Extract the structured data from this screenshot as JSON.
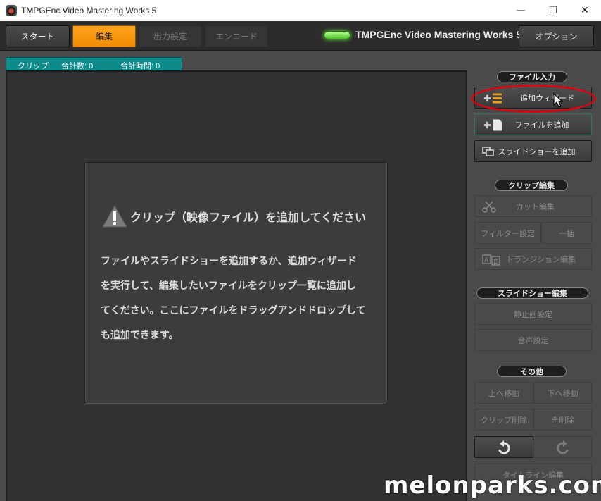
{
  "window": {
    "title": "TMPGEnc Video Mastering Works 5",
    "minimize": "—",
    "maximize": "☐",
    "close": "✕"
  },
  "toolbar": {
    "start": "スタート",
    "edit": "編集",
    "output_settings": "出力設定",
    "encode": "エンコード",
    "brand": "TMPGEnc Video Mastering Works 5",
    "options": "オプション"
  },
  "clip_tab": {
    "label": "クリップ",
    "total_count": "合計数:  0",
    "total_time": "合計時間:  0"
  },
  "message": {
    "title": "クリップ（映像ファイル）を追加してください",
    "lines": [
      "ファイルやスライドショーを追加するか、追加ウィザード",
      "を実行して、編集したいファイルをクリップ一覧に追加し",
      "てください。ここにファイルをドラッグアンドドロップして",
      "も追加できます。"
    ]
  },
  "side": {
    "file_input": "ファイル入力",
    "add_wizard": "追加ウィザード",
    "add_file": "ファイルを追加",
    "add_slideshow": "スライドショーを追加",
    "clip_edit": "クリップ編集",
    "cut_edit": "カット編集",
    "filter_settings": "フィルター設定",
    "batch": "一括",
    "transition_edit": "トランジション編集",
    "slideshow_edit": "スライドショー編集",
    "still_settings": "静止画設定",
    "audio_settings": "音声設定",
    "other": "その他",
    "move_up": "上へ移動",
    "move_down": "下へ移動",
    "clip_delete": "クリップ削除",
    "delete_all": "全削除",
    "timeline_edit": "タイムライン編集"
  },
  "watermark": "melonparks.com",
  "colors": {
    "accent_orange": "#f39600",
    "tab_teal": "#0d8a8a",
    "led_green": "#5fe23a",
    "highlight_red": "#e00010"
  }
}
